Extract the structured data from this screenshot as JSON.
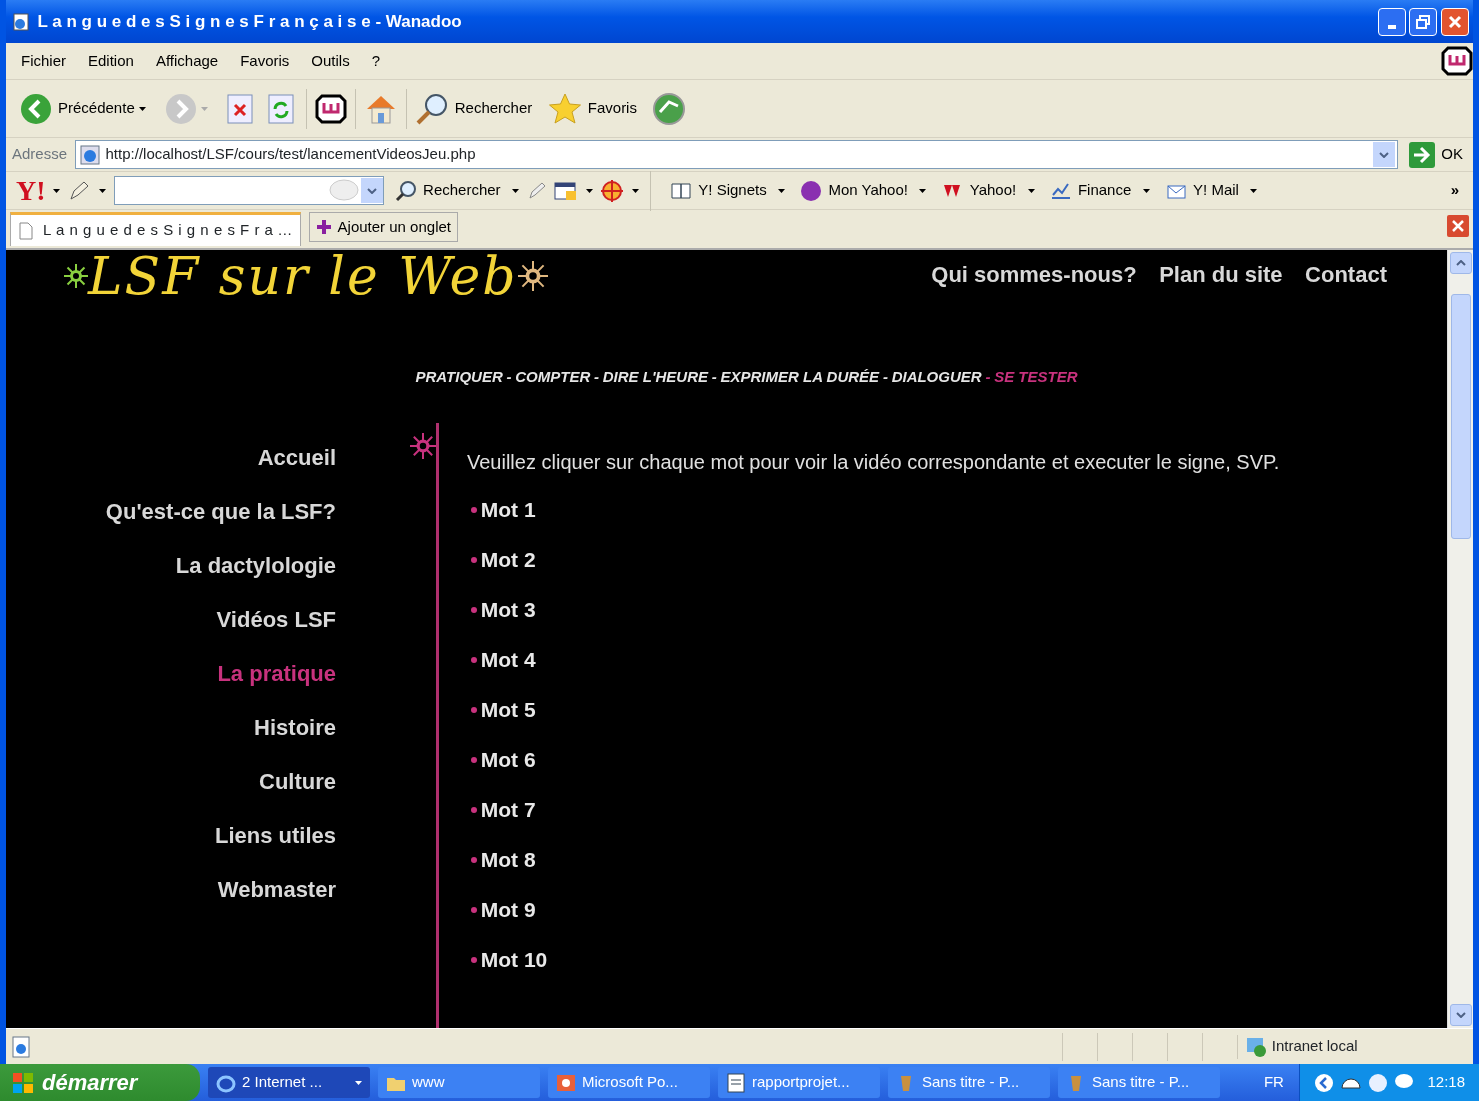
{
  "window": {
    "title": "L a n g u e d e s S i g n e s F r a n ç a i s e - Wanadoo"
  },
  "menu_bar": [
    "Fichier",
    "Edition",
    "Affichage",
    "Favoris",
    "Outils",
    "?"
  ],
  "toolbar": {
    "back": "Précédente",
    "search": "Rechercher",
    "favorites": "Favoris"
  },
  "address_bar": {
    "label": "Adresse",
    "url": "http://localhost/LSF/cours/test/lancementVideosJeu.php",
    "go": "OK"
  },
  "yahoo_toolbar": {
    "logo": "Y!",
    "search_button": "Rechercher",
    "links": [
      "Y! Signets",
      "Mon Yahoo!",
      "Yahoo!",
      "Finance",
      "Y! Mail"
    ],
    "more": "»"
  },
  "tabs": [
    {
      "label": "L a n g u e d e s S i g n e s F r a ...",
      "selected": true
    }
  ],
  "add_tab": "Ajouter un onglet",
  "page": {
    "logo": "LSF sur le Web",
    "top_links": [
      "Qui sommes-nous?",
      "Plan du site",
      "Contact"
    ],
    "separator": "-",
    "sections": [
      {
        "label": "PRATIQUER",
        "selected": false
      },
      {
        "label": "COMPTER",
        "selected": false
      },
      {
        "label": "DIRE L'HEURE",
        "selected": false
      },
      {
        "label": "EXPRIMER LA DURÉE",
        "selected": false
      },
      {
        "label": "DIALOGUER",
        "selected": false
      },
      {
        "label": "SE TESTER",
        "selected": true
      }
    ],
    "side_nav": [
      {
        "label": "Accueil",
        "selected": false
      },
      {
        "label": "Qu'est-ce que la LSF?",
        "selected": false
      },
      {
        "label": "La dactylologie",
        "selected": false
      },
      {
        "label": "Vidéos LSF",
        "selected": false
      },
      {
        "label": "La pratique",
        "selected": true
      },
      {
        "label": "Histoire",
        "selected": false
      },
      {
        "label": "Culture",
        "selected": false
      },
      {
        "label": "Liens utiles",
        "selected": false
      },
      {
        "label": "Webmaster",
        "selected": false
      }
    ],
    "intro": "Veuillez cliquer sur chaque mot pour voir la vidéo correspondante et executer le signe, SVP.",
    "words": [
      "Mot 1",
      "Mot 2",
      "Mot 3",
      "Mot 4",
      "Mot 5",
      "Mot 6",
      "Mot 7",
      "Mot 8",
      "Mot 9",
      "Mot 10"
    ]
  },
  "status_bar": {
    "zone": "Intranet local"
  },
  "taskbar": {
    "start": "démarrer",
    "tasks": [
      {
        "label": "2 Internet ...",
        "selected": true
      },
      {
        "label": "www",
        "selected": false
      },
      {
        "label": "Microsoft Po...",
        "selected": false
      },
      {
        "label": "rapportprojet...",
        "selected": false
      },
      {
        "label": "Sans titre - P...",
        "selected": false
      },
      {
        "label": "Sans titre - P...",
        "selected": false
      }
    ],
    "language": "FR",
    "clock": "12:18"
  }
}
